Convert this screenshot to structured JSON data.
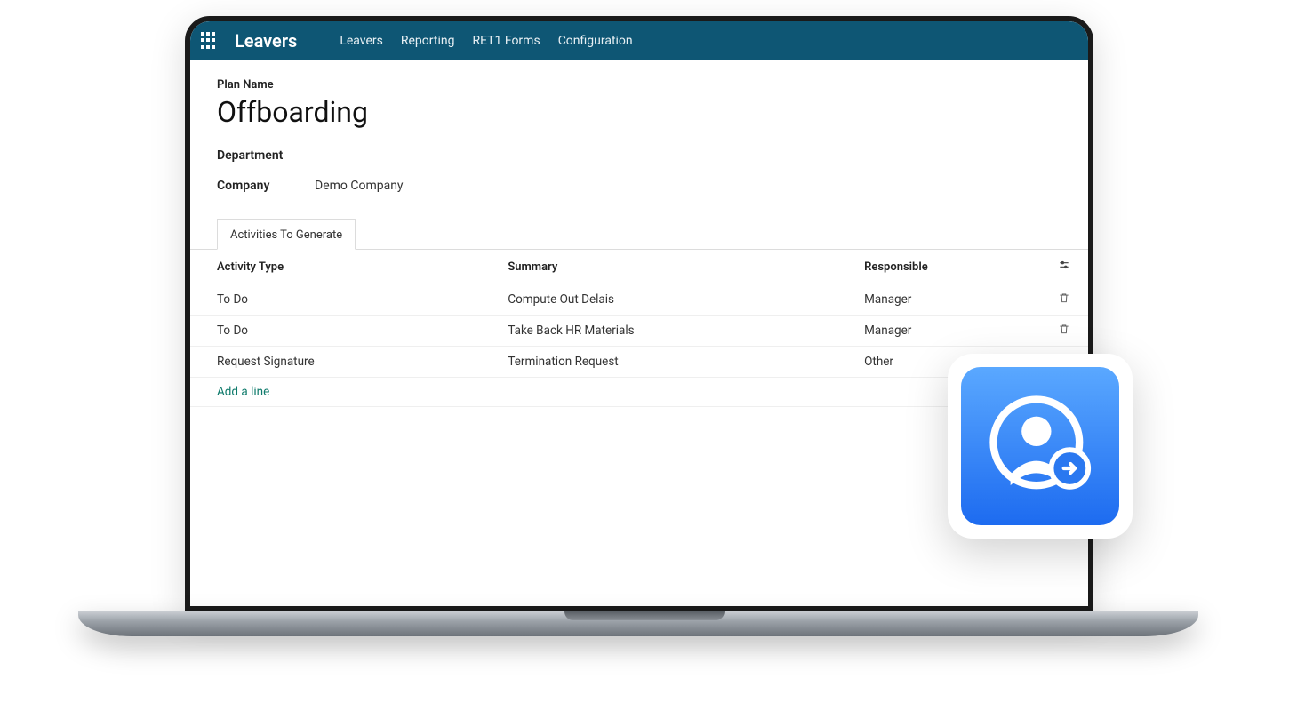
{
  "topnav": {
    "brand": "Leavers",
    "items": [
      "Leavers",
      "Reporting",
      "RET1 Forms",
      "Configuration"
    ]
  },
  "form": {
    "plan_name_label": "Plan Name",
    "plan_name_value": "Offboarding",
    "department_label": "Department",
    "department_value": "",
    "company_label": "Company",
    "company_value": "Demo Company"
  },
  "tab": {
    "label": "Activities To Generate"
  },
  "table": {
    "headers": {
      "activity_type": "Activity Type",
      "summary": "Summary",
      "responsible": "Responsible"
    },
    "rows": [
      {
        "activity_type": "To Do",
        "summary": "Compute Out Delais",
        "responsible": "Manager"
      },
      {
        "activity_type": "To Do",
        "summary": "Take Back HR Materials",
        "responsible": "Manager"
      },
      {
        "activity_type": "Request Signature",
        "summary": "Termination Request",
        "responsible": "Other"
      }
    ],
    "add_line_label": "Add a line"
  }
}
